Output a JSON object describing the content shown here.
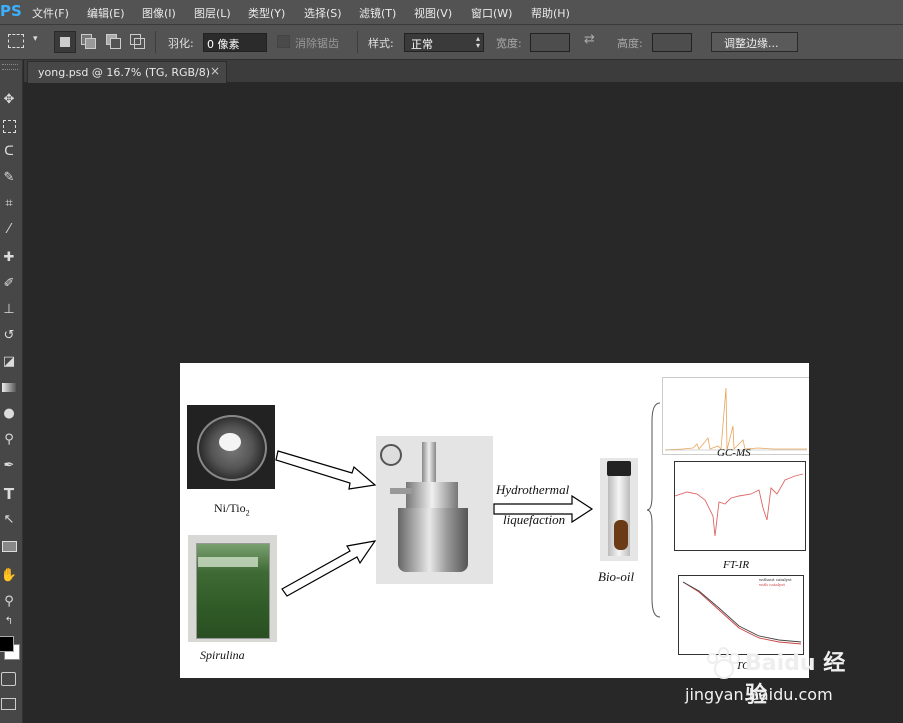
{
  "app": {
    "logo": "PS"
  },
  "menu": [
    "文件(F)",
    "编辑(E)",
    "图像(I)",
    "图层(L)",
    "类型(Y)",
    "选择(S)",
    "滤镜(T)",
    "视图(V)",
    "窗口(W)",
    "帮助(H)"
  ],
  "options": {
    "feather_label": "羽化:",
    "feather_value": "0 像素",
    "antialias_label": "消除锯齿",
    "style_label": "样式:",
    "style_value": "正常",
    "width_label": "宽度:",
    "height_label": "高度:",
    "refine_button": "调整边缘..."
  },
  "tab": {
    "title": "yong.psd @ 16.7% (TG, RGB/8)",
    "close": "×"
  },
  "tools": [
    "move-icon",
    "marquee-icon",
    "lasso-icon",
    "quick-select-icon",
    "crop-icon",
    "eyedropper-icon",
    "healing-icon",
    "brush-icon",
    "stamp-icon",
    "history-brush-icon",
    "eraser-icon",
    "gradient-icon",
    "blur-icon",
    "dodge-icon",
    "pen-icon",
    "type-icon",
    "path-select-icon",
    "shape-icon",
    "hand-icon",
    "zoom-icon"
  ],
  "figure": {
    "catalyst_label": "Ni/Tio",
    "catalyst_sub": "2",
    "feedstock_label": "Spirulina",
    "process_line1": "Hydrothermal",
    "process_line2": "liquefaction",
    "product_label": "Bio-oil",
    "gcms_label": "GC-MS",
    "ftir_label": "FT-IR",
    "tg_label": "TG",
    "legend1": "without catalyst",
    "legend2": "with catalyst"
  },
  "watermark": {
    "brand": "Baidu 经验",
    "url": "jingyan.baidu.com"
  }
}
